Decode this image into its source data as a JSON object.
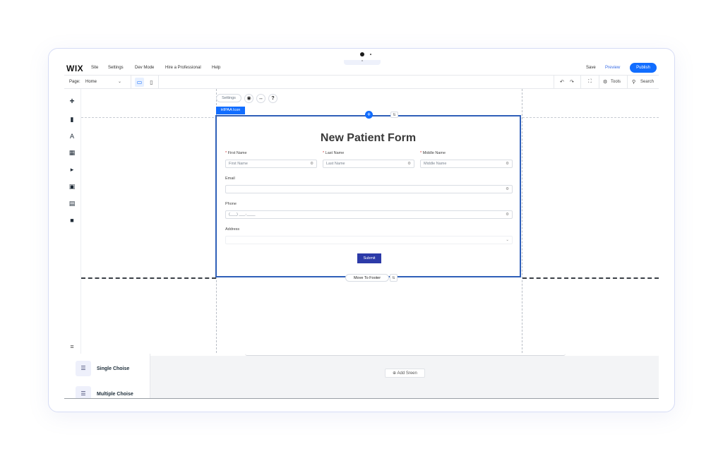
{
  "topbar": {
    "logo": "WIX",
    "menu": [
      "Site",
      "Settings",
      "Dev Mode",
      "Hire a Professional",
      "Help"
    ],
    "pull_tab": "^",
    "save": "Save",
    "preview": "Preview",
    "publish": "Publish"
  },
  "secbar": {
    "page_label": "Page:",
    "page_value": "Home",
    "chevron": "⌄",
    "tools": "Tools",
    "search": "Search"
  },
  "canvas": {
    "settings_chip": "Settings",
    "element_tag": "HIPAA Icon",
    "move_to_footer": "Move To Footer"
  },
  "form": {
    "title": "New Patient Form",
    "first_name_label": "First Name",
    "first_name_placeholder": "First Name",
    "last_name_label": "Last Name",
    "last_name_placeholder": "Last Name",
    "middle_name_label": "Middle Name",
    "middle_name_placeholder": "Middle Name",
    "email_label": "Email",
    "email_value": "",
    "phone_label": "Phone",
    "phone_placeholder": "(___) ___-____",
    "address_label": "Address",
    "address_value": "",
    "submit": "Submit",
    "required_mark": "*"
  },
  "bottom": {
    "add_screen": "Add Sreen",
    "panel_items": [
      "Single Choise",
      "Multiple Choise"
    ]
  },
  "colors": {
    "accent": "#116dff",
    "form_border": "#2f5fb8",
    "submit_bg": "#2c3aa8"
  }
}
